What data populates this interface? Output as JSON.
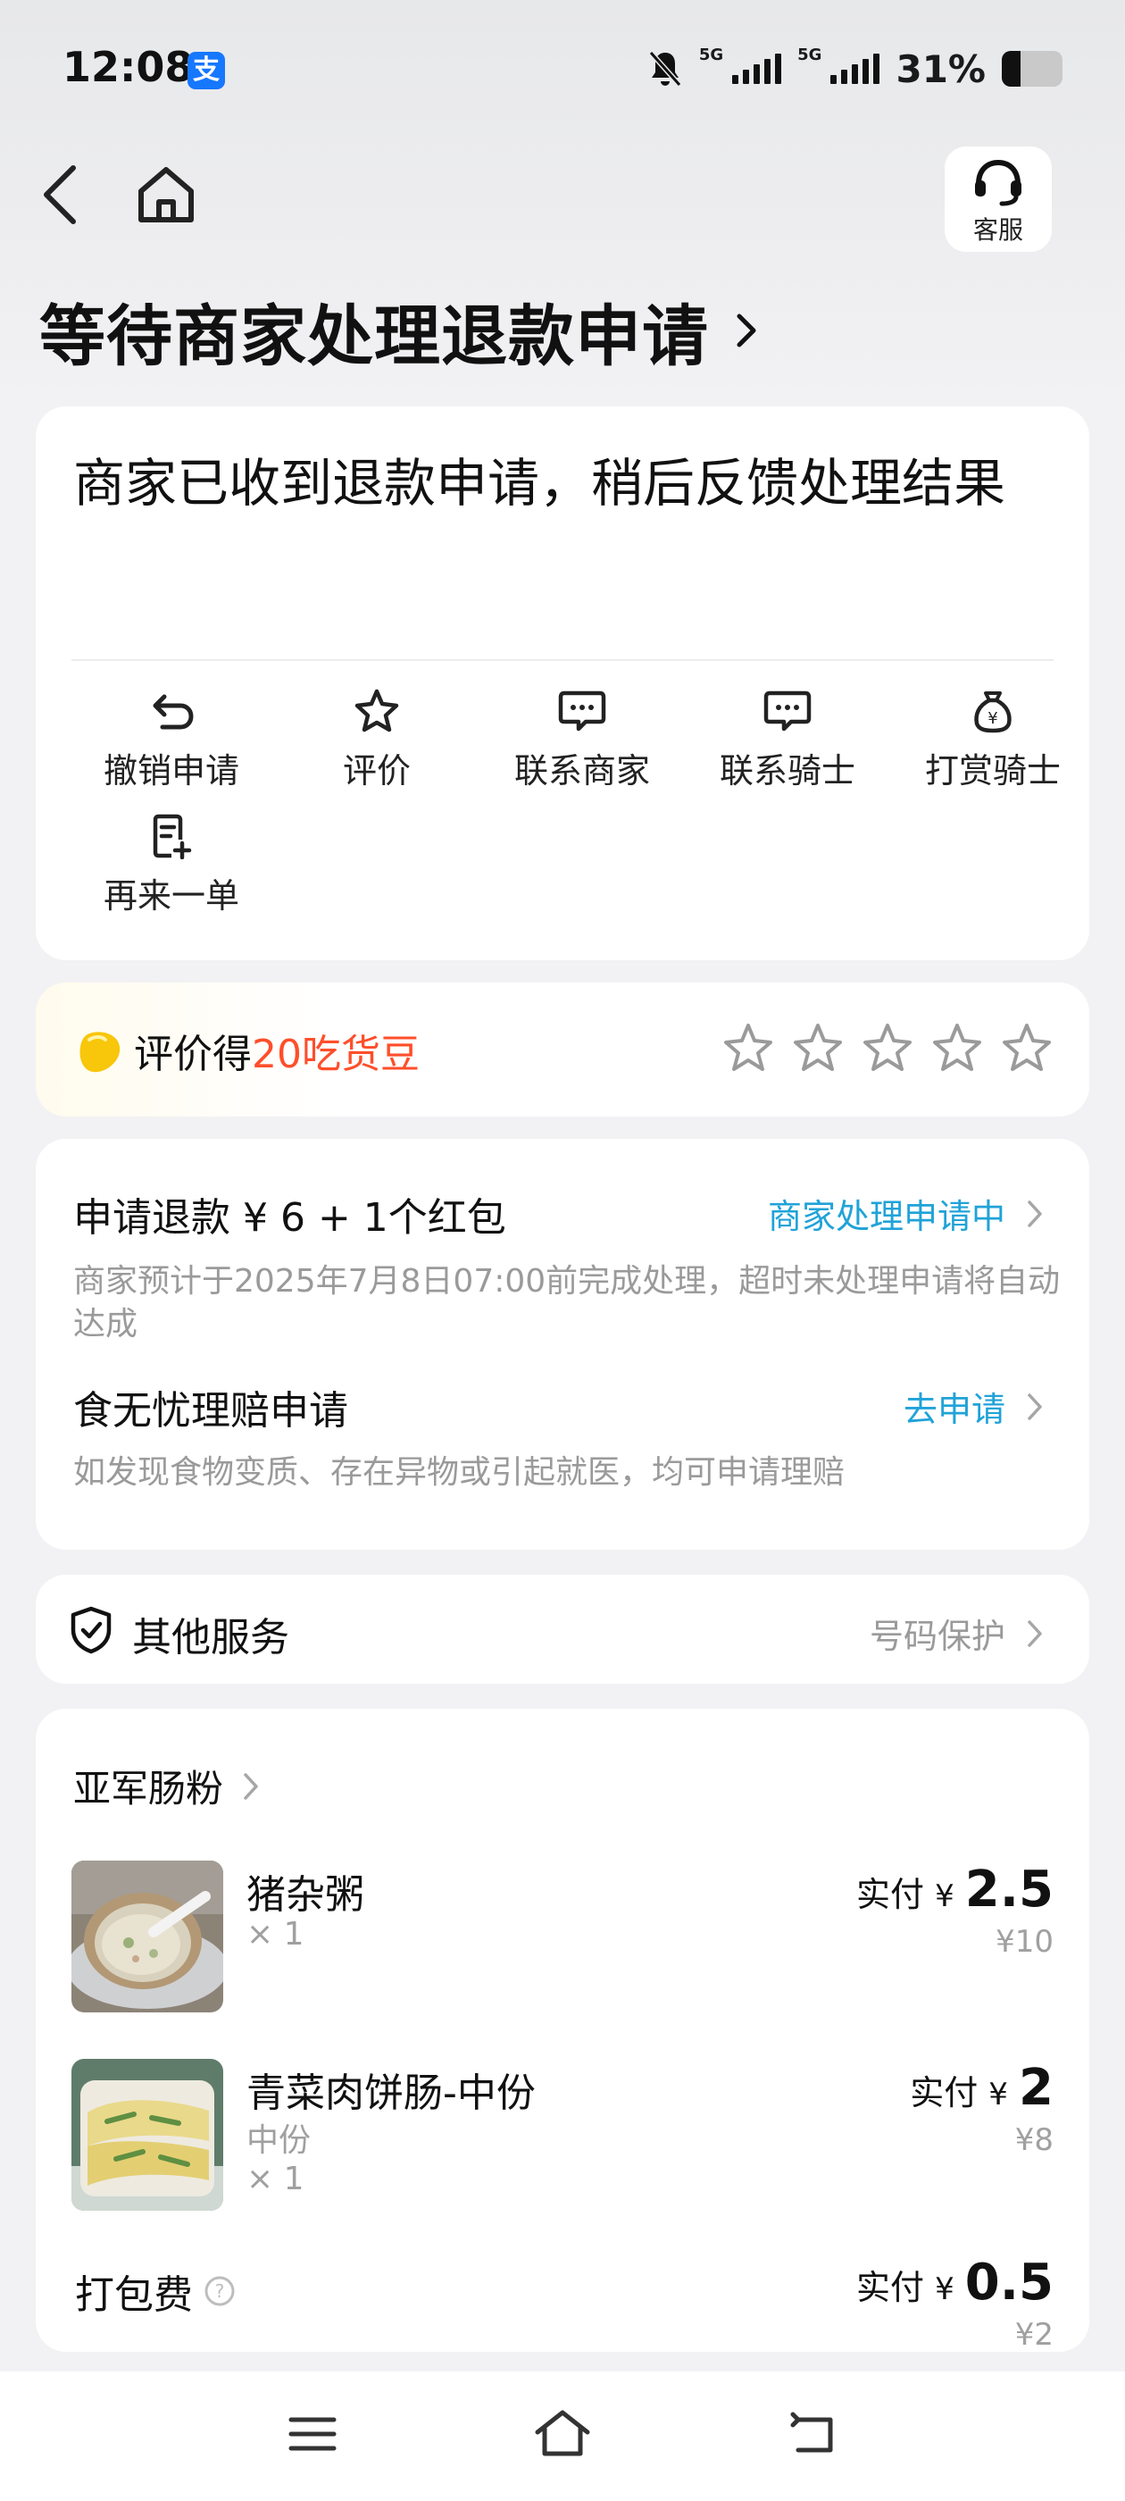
{
  "status_bar": {
    "time": "12:08",
    "alipay_badge": "支",
    "signal1_label": "5G",
    "signal2_label": "5G",
    "battery": "31%",
    "battery_level": 0.31
  },
  "nav": {
    "customer_service_label": "客服"
  },
  "page_title": "等待商家处理退款申请",
  "status_card": {
    "message": "商家已收到退款申请，稍后反馈处理结果",
    "actions": [
      {
        "label": "撤销申请",
        "icon": "undo-icon"
      },
      {
        "label": "评价",
        "icon": "star-icon"
      },
      {
        "label": "联系商家",
        "icon": "chat-icon"
      },
      {
        "label": "联系骑士",
        "icon": "chat-icon"
      },
      {
        "label": "打赏骑士",
        "icon": "money-bag-icon"
      },
      {
        "label": "再来一单",
        "icon": "reorder-icon"
      }
    ]
  },
  "review": {
    "prefix": "评价得",
    "highlight": "20吃货豆",
    "stars": 5,
    "highlight_color": "#ff4e2a"
  },
  "refund": {
    "title": "申请退款 ¥ 6 + 1个红包",
    "status_link": "商家处理申请中",
    "note": "商家预计于2025年7月8日07:00前完成处理，超时未处理申请将自动达成",
    "claim_title": "食无忧理赔申请",
    "claim_link": "去申请",
    "claim_note": "如发现食物变质、存在异物或引起就医，均可申请理赔",
    "link_color": "#20a3d8"
  },
  "services": {
    "title": "其他服务",
    "link": "号码保护"
  },
  "order": {
    "shop_name": "亚军肠粉",
    "items": [
      {
        "name": "猪杂粥",
        "spec": "",
        "qty": "× 1",
        "paid_label": "实付",
        "currency": "¥",
        "paid": "2.5",
        "original": "¥10"
      },
      {
        "name": "青菜肉饼肠-中份",
        "spec": "中份",
        "qty": "× 1",
        "paid_label": "实付",
        "currency": "¥",
        "paid": "2",
        "original": "¥8"
      }
    ],
    "packaging": {
      "label": "打包费",
      "paid_label": "实付",
      "currency": "¥",
      "paid": "0.5",
      "original": "¥2"
    }
  }
}
